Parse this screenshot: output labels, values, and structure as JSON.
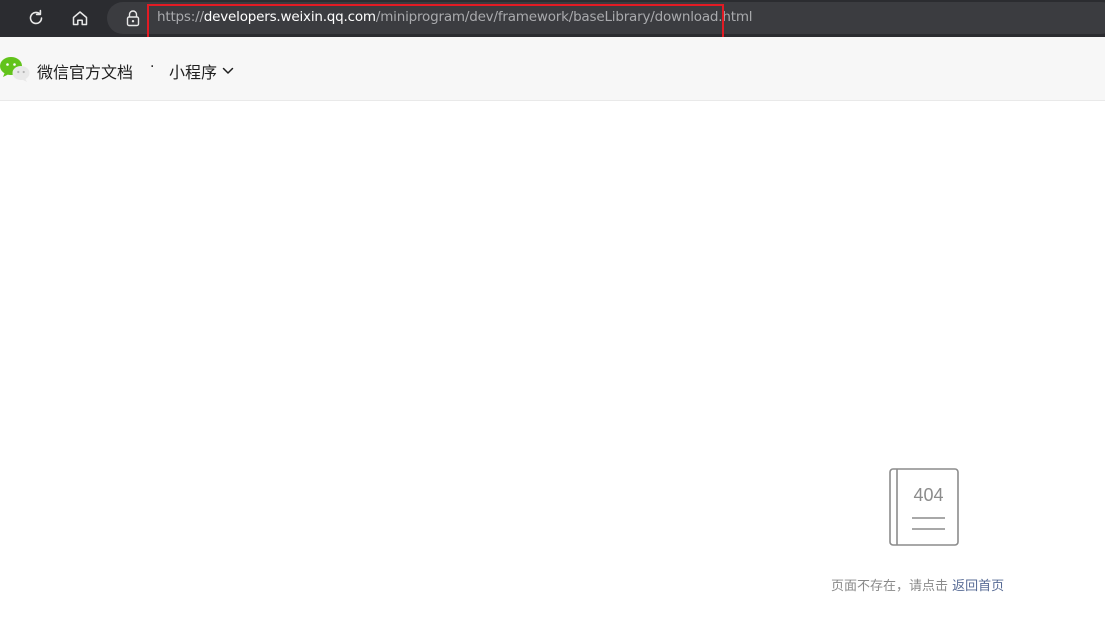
{
  "browser": {
    "url_scheme": "https://",
    "url_host": "developers.weixin.qq.com",
    "url_path": "/miniprogram/dev/framework/baseLibrary/download.html",
    "icons": [
      "refresh-icon",
      "home-icon",
      "lock-icon"
    ],
    "highlight_color": "#e21b24"
  },
  "header": {
    "logo_icon": "wechat-logo",
    "title": "微信官方文档",
    "separator": "·",
    "section": "小程序",
    "section_icon": "chevron-down-icon"
  },
  "notfound": {
    "code": "404",
    "message": "页面不存在，请点击",
    "home_link": "返回首页",
    "link_color": "#576b95"
  }
}
